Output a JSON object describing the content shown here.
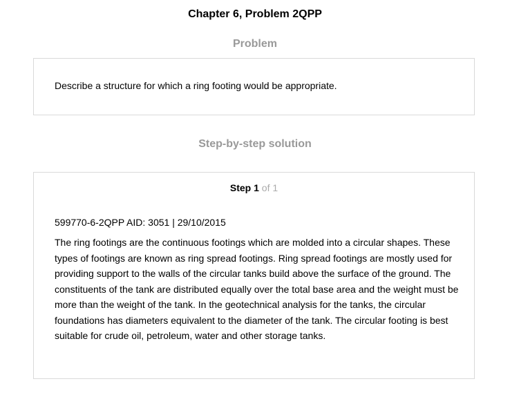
{
  "header": {
    "title": "Chapter 6, Problem 2QPP"
  },
  "problem": {
    "heading": "Problem",
    "text": "Describe a structure for which a ring footing would be appropriate."
  },
  "solution": {
    "heading": "Step-by-step solution",
    "step": {
      "word": "Step",
      "current": "1",
      "of_total": "of 1"
    },
    "meta": "599770-6-2QPP AID: 3051 | 29/10/2015",
    "body": "The ring footings are the continuous footings which are molded into a circular shapes. These types of footings are known as ring spread footings. Ring spread footings are mostly used for providing support to the walls of the circular tanks build above the surface of the ground. The constituents of the tank are distributed equally over the total base area and the weight must be more than the weight of the tank. In the geotechnical analysis for the tanks, the circular foundations has diameters equivalent to the diameter of the tank. The circular footing is best suitable for crude oil, petroleum, water and other storage tanks."
  }
}
